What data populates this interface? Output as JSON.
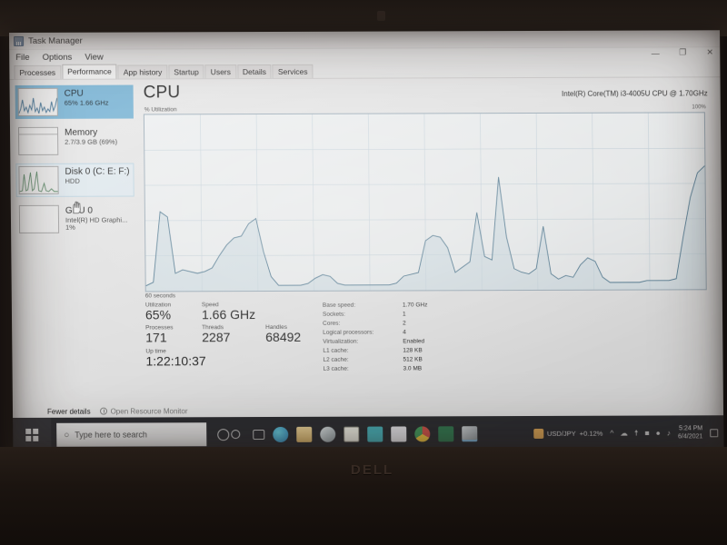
{
  "device": {
    "brand": "DELL"
  },
  "window": {
    "title": "Task Manager",
    "icon": "task-manager-icon",
    "controls": {
      "minimize": "—",
      "maximize": "❐",
      "close": "✕"
    },
    "menu": [
      "File",
      "Options",
      "View"
    ],
    "tabs": [
      {
        "label": "Processes",
        "active": false
      },
      {
        "label": "Performance",
        "active": true
      },
      {
        "label": "App history",
        "active": false
      },
      {
        "label": "Startup",
        "active": false
      },
      {
        "label": "Users",
        "active": false
      },
      {
        "label": "Details",
        "active": false
      },
      {
        "label": "Services",
        "active": false
      }
    ]
  },
  "sidebar": {
    "items": [
      {
        "name": "CPU",
        "sub": "65%  1.66 GHz",
        "state": "selected"
      },
      {
        "name": "Memory",
        "sub": "2.7/3.9 GB (69%)",
        "state": "normal"
      },
      {
        "name": "Disk 0 (C: E: F:)",
        "sub": "HDD",
        "state": "hover"
      },
      {
        "name": "GPU 0",
        "sub2": "Intel(R) HD Graphi...",
        "sub": "1%",
        "state": "normal"
      }
    ]
  },
  "main": {
    "heading": "CPU",
    "model": "Intel(R) Core(TM) i3-4005U CPU @ 1.70GHz",
    "y_axis_label": "% Utilization",
    "y_max_label": "100%",
    "x_axis_label": "60 seconds",
    "stats": {
      "labels": {
        "utilization": "Utilization",
        "speed": "Speed",
        "processes": "Processes",
        "threads": "Threads",
        "handles": "Handles",
        "uptime": "Up time"
      },
      "values": {
        "utilization": "65%",
        "speed": "1.66 GHz",
        "processes": "171",
        "threads": "2287",
        "handles": "68492",
        "uptime": "1:22:10:37"
      }
    },
    "specs": [
      {
        "key": "Base speed:",
        "value": "1.70 GHz"
      },
      {
        "key": "Sockets:",
        "value": "1"
      },
      {
        "key": "Cores:",
        "value": "2"
      },
      {
        "key": "Logical processors:",
        "value": "4"
      },
      {
        "key": "Virtualization:",
        "value": "Enabled"
      },
      {
        "key": "L1 cache:",
        "value": "128 KB"
      },
      {
        "key": "L2 cache:",
        "value": "512 KB"
      },
      {
        "key": "L3 cache:",
        "value": "3.0 MB"
      }
    ]
  },
  "footer": {
    "fewer_details": "Fewer details",
    "resource_monitor": "Open Resource Monitor"
  },
  "taskbar": {
    "start": "start-button",
    "search_placeholder": "Type here to search",
    "icons": [
      "task-view-icon",
      "edge-icon",
      "file-explorer-icon",
      "opera-icon",
      "notes-icon",
      "store-icon",
      "onenote-icon",
      "chrome-icon",
      "excel-icon",
      "task-manager-icon"
    ],
    "news": "USD/JPY",
    "news_value": "+0.12%",
    "clock_time": "5:24 PM",
    "clock_date": "6/4/2021"
  },
  "chart_data": {
    "type": "area",
    "title": "CPU % Utilization",
    "xlabel": "60 seconds",
    "ylabel": "% Utilization",
    "ylim": [
      0,
      100
    ],
    "xlim": [
      0,
      60
    ],
    "grid": true,
    "line_color": "#4a7f9e",
    "fill_color": "#cfe3ef",
    "values": [
      3,
      5,
      45,
      42,
      10,
      12,
      11,
      10,
      11,
      13,
      20,
      26,
      30,
      31,
      38,
      41,
      22,
      8,
      3,
      3,
      3,
      3,
      4,
      7,
      9,
      8,
      4,
      3,
      3,
      3,
      3,
      3,
      3,
      3,
      4,
      8,
      9,
      10,
      28,
      31,
      30,
      24,
      10,
      13,
      16,
      44,
      19,
      17,
      64,
      30,
      12,
      10,
      9,
      12,
      36,
      9,
      6,
      8,
      7,
      14,
      18,
      16,
      7,
      4,
      4,
      4,
      4,
      4,
      5,
      5,
      5,
      5,
      6,
      30,
      52,
      66,
      70
    ]
  }
}
